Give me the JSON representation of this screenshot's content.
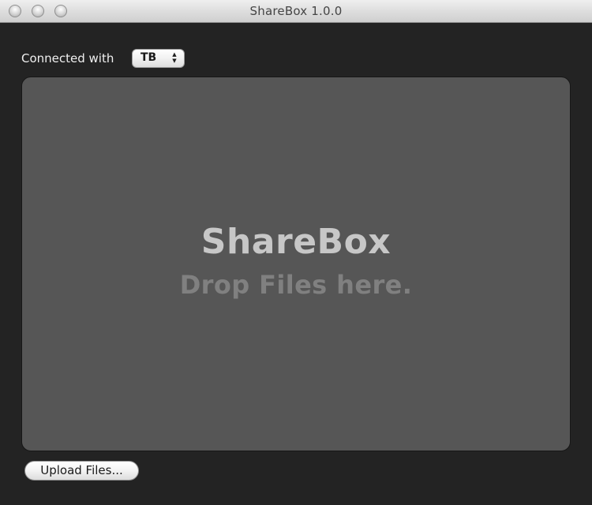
{
  "window": {
    "title": "ShareBox 1.0.0"
  },
  "connection": {
    "label": "Connected with",
    "selected": "TB",
    "arrow_up": "▲",
    "arrow_down": "▼"
  },
  "drop_zone": {
    "title": "ShareBox",
    "subtitle": "Drop Files here."
  },
  "actions": {
    "upload_label": "Upload Files..."
  },
  "colors": {
    "background": "#232323",
    "drop_zone": "#565656",
    "title_text": "#c7c7c7",
    "subtitle_text": "#808080"
  }
}
